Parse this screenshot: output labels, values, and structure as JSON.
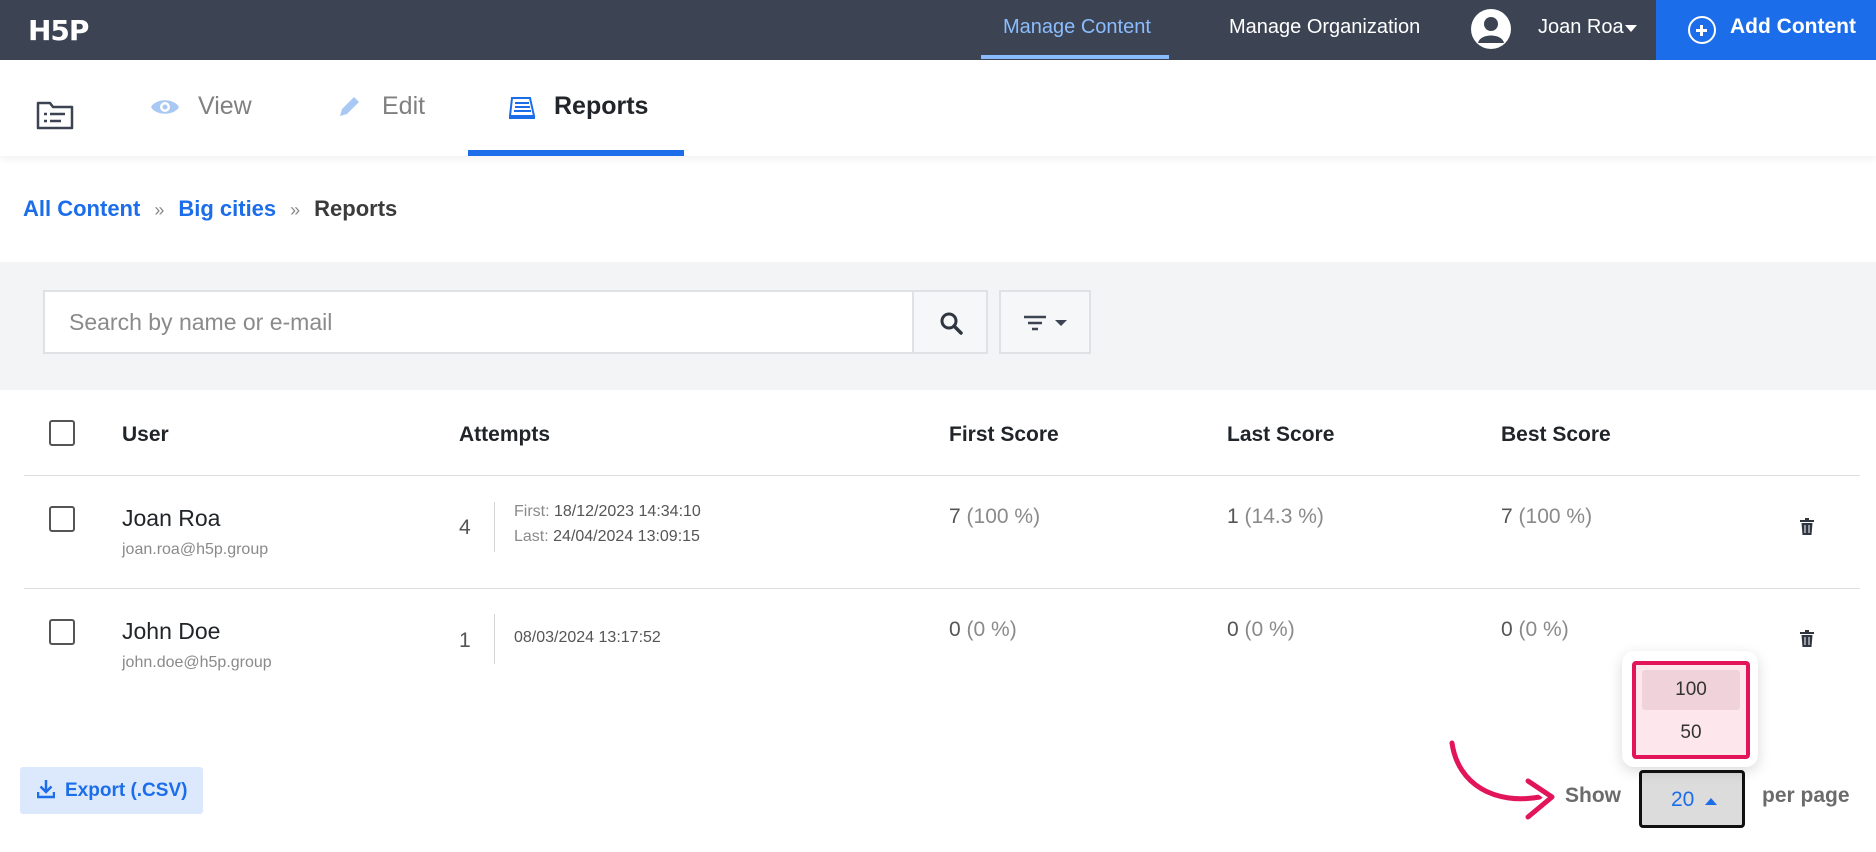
{
  "topbar": {
    "logo": "H5P",
    "nav": [
      "Manage Content",
      "Manage Organization"
    ],
    "user_name": "Joan Roa",
    "add_content": "Add Content"
  },
  "tabs": [
    "View",
    "Edit",
    "Reports"
  ],
  "breadcrumb": {
    "items": [
      "All Content",
      "Big cities"
    ],
    "current": "Reports"
  },
  "search": {
    "placeholder": "Search by name or e-mail"
  },
  "table": {
    "headers": [
      "User",
      "Attempts",
      "First Score",
      "Last Score",
      "Best Score"
    ],
    "rows": [
      {
        "name": "Joan Roa",
        "email": "joan.roa@h5p.group",
        "attempts": "4",
        "first_label": "First:",
        "first": "18/12/2023 14:34:10",
        "last_label": "Last:",
        "last": "24/04/2024 13:09:15",
        "first_score": "7",
        "first_pct": "(100 %)",
        "last_score": "1",
        "last_pct": "(14.3 %)",
        "best_score": "7",
        "best_pct": "(100 %)"
      },
      {
        "name": "John Doe",
        "email": "john.doe@h5p.group",
        "attempts": "1",
        "date": "08/03/2024 13:17:52",
        "first_score": "0",
        "first_pct": "(0 %)",
        "last_score": "0",
        "last_pct": "(0 %)",
        "best_score": "0",
        "best_pct": "(0 %)"
      }
    ]
  },
  "footer": {
    "export": "Export (.CSV)",
    "show": "Show",
    "per_page_value": "20",
    "per_page": "per page",
    "options": [
      "100",
      "50"
    ]
  },
  "colors": {
    "nav_bg": "#3c4453",
    "accent": "#1c6dea",
    "highlight": "#e2145a"
  }
}
